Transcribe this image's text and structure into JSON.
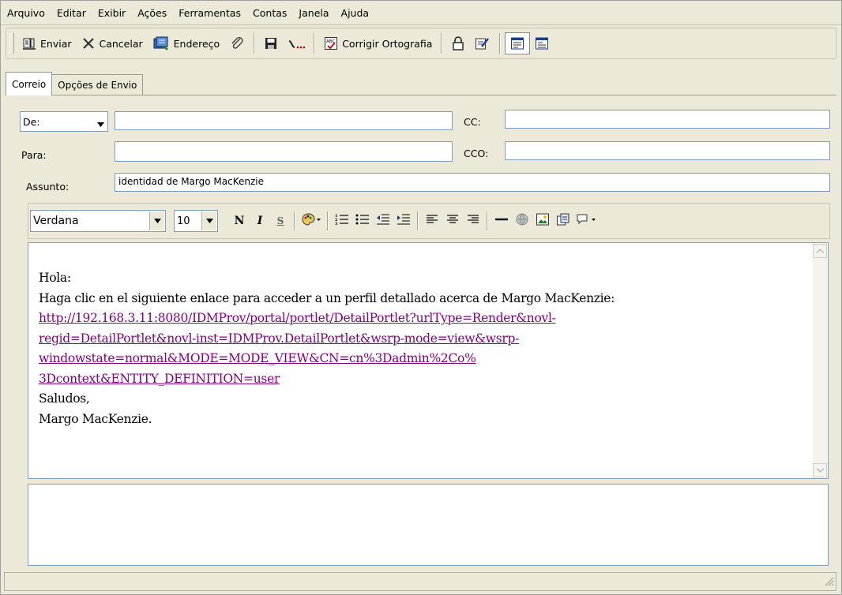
{
  "menu": [
    "Arquivo",
    "Editar",
    "Exibir",
    "Ações",
    "Ferramentas",
    "Contas",
    "Janela",
    "Ajuda"
  ],
  "toolbar": {
    "send": "Enviar",
    "cancel": "Cancelar",
    "address": "Endereço",
    "spell": "Corrigir Ortografia"
  },
  "tabs": [
    "Correio",
    "Opções de Envio"
  ],
  "header": {
    "from_label": "De:",
    "cc_label": "CC:",
    "to_label": "Para:",
    "bcc_label": "CCO:",
    "subject_label": "Assunto:",
    "from_value": "",
    "cc_value": "",
    "to_value": "",
    "bcc_value": "",
    "subject_value": "identidad de Margo MacKenzie"
  },
  "format": {
    "font": "Verdana",
    "size": "10",
    "bold": "N",
    "italic": "I",
    "strike": "S"
  },
  "body": {
    "greeting": "Hola:",
    "intro": "Haga clic en el siguiente enlace para acceder a un perfil detallado acerca de Margo MacKenzie:",
    "link_lines": [
      "http://192.168.3.11:8080/IDMProv/portal/portlet/DetailPortlet?urlType=Render&novl-",
      "regid=DetailPortlet&novl-inst=IDMProv.DetailPortlet&wsrp-mode=view&wsrp-",
      "windowstate=normal&MODE=MODE_VIEW&CN=cn%3Dadmin%2Co%",
      "3Dcontext&ENTITY_DEFINITION=user"
    ],
    "closing": "Saludos,",
    "signature": "Margo MacKenzie."
  },
  "colors": {
    "link": "#800080",
    "chrome": "#ece9d8",
    "field_border": "#7f9db9"
  },
  "icons": [
    "send-icon",
    "cancel-icon",
    "address-book-icon",
    "attach-icon",
    "save-icon",
    "signature-icon",
    "spell-check-icon",
    "lock-icon",
    "sign-icon",
    "view-icon-1",
    "view-icon-2"
  ]
}
